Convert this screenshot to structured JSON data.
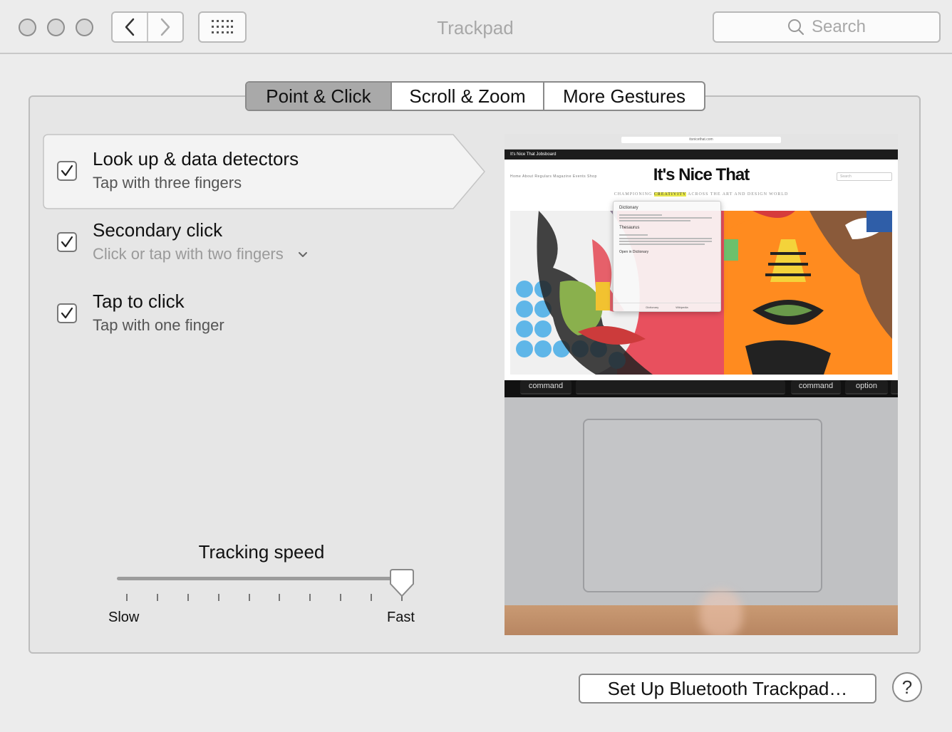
{
  "window": {
    "title": "Trackpad",
    "search_placeholder": "Search"
  },
  "tabs": [
    {
      "label": "Point & Click",
      "active": true
    },
    {
      "label": "Scroll & Zoom",
      "active": false
    },
    {
      "label": "More Gestures",
      "active": false
    }
  ],
  "options": [
    {
      "title": "Look up & data detectors",
      "subtitle": "Tap with three fingers",
      "checked": true,
      "selected": true
    },
    {
      "title": "Secondary click",
      "subtitle": "Click or tap with two fingers",
      "checked": true,
      "has_dropdown": true
    },
    {
      "title": "Tap to click",
      "subtitle": "Tap with one finger",
      "checked": true
    }
  ],
  "tracking": {
    "label": "Tracking speed",
    "min_label": "Slow",
    "max_label": "Fast",
    "value_fraction": 1.0,
    "tick_count": 10
  },
  "preview": {
    "url": "itsnicethat.com",
    "site_nav": "It's Nice That   Jobsboard",
    "menu": "Home   About   Regulars   Magazine   Events   Shop",
    "logo": "It's Nice That",
    "search": "Search",
    "tagline_before": "CHAMPIONING ",
    "tagline_highlight": "CREATIVITY",
    "tagline_after": " ACROSS THE ART AND DESIGN WORLD",
    "popup_dictionary": "Dictionary",
    "popup_thesaurus": "Thesaurus",
    "popup_open": "Open in Dictionary",
    "popup_tab1": "Dictionary",
    "popup_tab2": "Wikipedia",
    "keys": [
      "command",
      "command",
      "option"
    ]
  },
  "bottom": {
    "setup_button": "Set Up Bluetooth Trackpad…",
    "help": "?"
  },
  "colors": {
    "window_bg": "#ececec",
    "active_tab": "#a9a9a9",
    "title_text": "#a8a8a8"
  }
}
